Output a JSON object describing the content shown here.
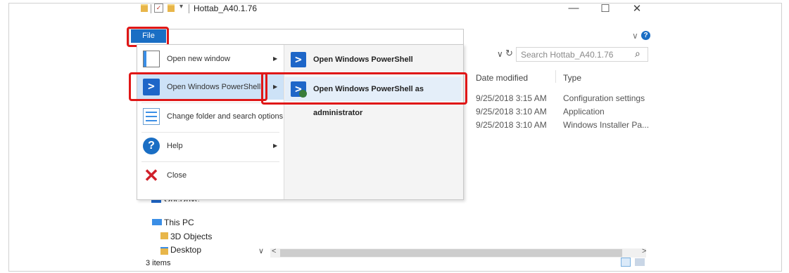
{
  "window": {
    "title": "Hottab_A40.1.76",
    "minimize_glyph": "—",
    "maximize_glyph": "☐",
    "close_glyph": "✕"
  },
  "ribbon": {
    "file_tab_label": "File",
    "expand_glyph": "∨",
    "help_glyph": "?"
  },
  "file_menu": {
    "items": [
      {
        "label": "Open new window",
        "icon": "new-window-icon",
        "has_submenu": true
      },
      {
        "label": "Open Windows PowerShell",
        "icon": "powershell-icon",
        "has_submenu": true,
        "highlighted": true
      },
      {
        "label": "Change folder and search options",
        "icon": "options-icon",
        "has_submenu": false
      },
      {
        "label": "Help",
        "icon": "help-icon",
        "has_submenu": true
      },
      {
        "label": "Close",
        "icon": "close-icon",
        "has_submenu": false
      }
    ],
    "submenu_arrow": "▶",
    "submenu": [
      {
        "label": "Open Windows PowerShell",
        "icon": "powershell-icon"
      },
      {
        "label": "Open Windows PowerShell as administrator",
        "icon": "powershell-admin-icon",
        "highlighted": true
      }
    ]
  },
  "address": {
    "dropdown_glyph": "∨",
    "refresh_glyph": "↻",
    "search_placeholder": "Search Hottab_A40.1.76",
    "search_icon_glyph": "⌕"
  },
  "columns": [
    "Date modified",
    "Type"
  ],
  "rows": [
    {
      "date": "9/25/2018 3:15 AM",
      "type": "Configuration settings"
    },
    {
      "date": "9/25/2018 3:10 AM",
      "type": "Application"
    },
    {
      "date": "9/25/2018 3:10 AM",
      "type": "Windows Installer Pa..."
    }
  ],
  "nav_pane": {
    "items": [
      {
        "label": "OneDrive",
        "icon": "onedrive-icon"
      },
      {
        "label": "This PC",
        "icon": "this-pc-icon"
      },
      {
        "label": "3D Objects",
        "icon": "3d-objects-icon"
      },
      {
        "label": "Desktop",
        "icon": "desktop-folder-icon"
      }
    ]
  },
  "status_bar": {
    "item_count": "3 items",
    "scroll_left": "<",
    "scroll_right": ">",
    "nav_scroll_down": "∨"
  },
  "colors": {
    "accent": "#1a6ec4",
    "highlight_red": "#e01717",
    "folder_yellow": "#e8b64a"
  }
}
